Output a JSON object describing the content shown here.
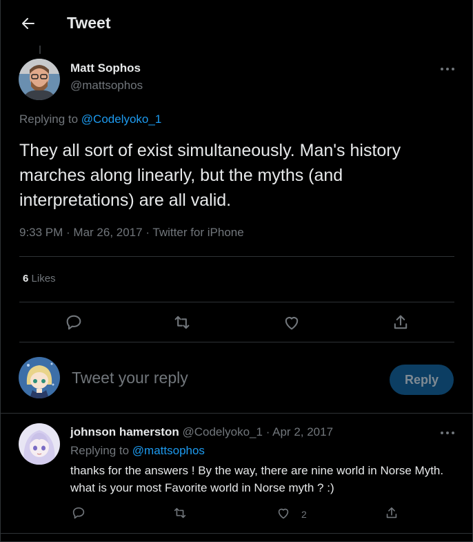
{
  "header": {
    "title": "Tweet",
    "back_icon": "arrow-left-icon"
  },
  "tweet": {
    "author_name": "Matt Sophos",
    "author_handle": "@mattsophos",
    "replying_prefix": "Replying to",
    "replying_to": "@Codelyoko_1",
    "text": "They all sort of exist simultaneously. Man's history marches along linearly, but the myths (and interpretations) are all valid.",
    "time": "9:33 PM",
    "date": "Mar 26, 2017",
    "source": "Twitter for iPhone",
    "likes_count": "6",
    "likes_label": "Likes"
  },
  "composer": {
    "placeholder": "Tweet your reply",
    "reply_button": "Reply"
  },
  "reply": {
    "author_name": "johnson hamerston",
    "author_handle": "@Codelyoko_1",
    "date": "Apr 2, 2017",
    "replying_prefix": "Replying to",
    "replying_to": "@mattsophos",
    "text": "thanks for the answers ! By the way, there are nine world in Norse Myth. what is your most Favorite world in Norse myth ? :)",
    "like_count": "2"
  },
  "colors": {
    "accent": "#1d9bf0",
    "background": "#000000",
    "muted": "#71767b",
    "reply_button_bg": "#0c3e63"
  }
}
